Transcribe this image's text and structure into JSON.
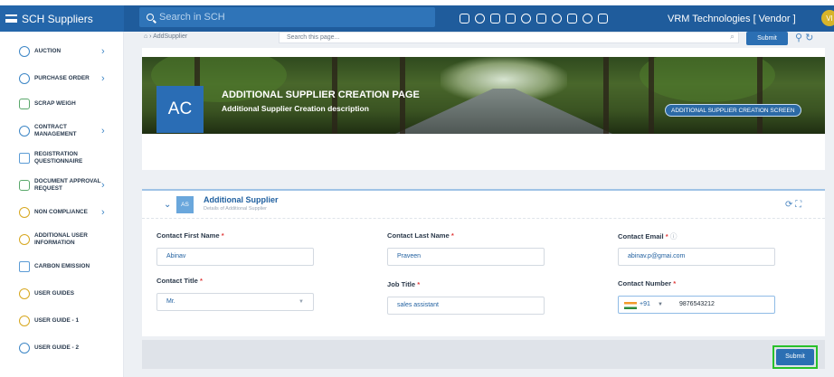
{
  "header": {
    "brand": "SCH Suppliers",
    "search_placeholder": "Search in SCH",
    "company": "VRM Technologies  [ Vendor ]",
    "avatar_initials": "VI"
  },
  "sidebar": {
    "items": [
      {
        "label": "AUCTION",
        "icon": "clock-icon",
        "arrow": true
      },
      {
        "label": "PURCHASE ORDER",
        "icon": "clock-icon",
        "arrow": true
      },
      {
        "label": "SCRAP WEIGH",
        "icon": "home-icon",
        "arrow": false
      },
      {
        "label": "CONTRACT MANAGEMENT",
        "icon": "clock-icon",
        "arrow": true
      },
      {
        "label": "REGISTRATION QUESTIONNAIRE",
        "icon": "users-icon",
        "arrow": false
      },
      {
        "label": "DOCUMENT APPROVAL REQUEST",
        "icon": "mail-icon",
        "arrow": true
      },
      {
        "label": "NON COMPLIANCE",
        "icon": "clock-icon",
        "arrow": true
      },
      {
        "label": "ADDITIONAL USER INFORMATION",
        "icon": "clock-icon",
        "arrow": false
      },
      {
        "label": "CARBON EMISSION",
        "icon": "user-icon",
        "arrow": false
      },
      {
        "label": "USER GUIDES",
        "icon": "question-icon",
        "arrow": false
      },
      {
        "label": "USER GUIDE - 1",
        "icon": "question-icon",
        "arrow": false
      },
      {
        "label": "USER GUIDE - 2",
        "icon": "question-icon",
        "arrow": false
      }
    ]
  },
  "topbar": {
    "breadcrumb": "⌂ › AddSupplier",
    "page_search_placeholder": "Search this page...",
    "submit": "Submit"
  },
  "banner": {
    "title": "ADDITIONAL SUPPLIER CREATION PAGE",
    "description": "Additional Supplier Creation description",
    "initials": "AC",
    "screen_badge": "ADDITIONAL SUPPLIER CREATION SCREEN"
  },
  "section": {
    "badge": "AS",
    "title": "Additional Supplier",
    "subtitle": "Details of Additional Supplier"
  },
  "form": {
    "first_name_label": "Contact First Name",
    "first_name_value": "Abinav",
    "last_name_label": "Contact Last Name",
    "last_name_value": "Praveen",
    "email_label": "Contact Email",
    "email_value": "abinav.p@gmai.com",
    "title_label": "Contact Title",
    "title_value": "Mr.",
    "job_title_label": "Job Title",
    "job_title_value": "sales assistant",
    "number_label": "Contact Number",
    "country_code": "+91",
    "number_value": "9876543212",
    "required_mark": "*"
  },
  "footer": {
    "submit": "Submit"
  }
}
